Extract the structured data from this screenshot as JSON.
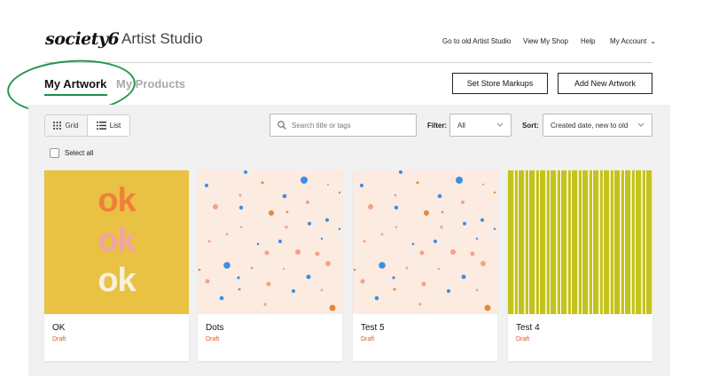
{
  "header": {
    "logo": "society6",
    "title": "Artist Studio",
    "nav": {
      "old_studio": "Go to old Artist Studio",
      "view_shop": "View My Shop",
      "help": "Help",
      "account": "My Account"
    }
  },
  "tabs": {
    "artwork": "My Artwork",
    "products": "My Products"
  },
  "actions": {
    "markups": "Set Store Markups",
    "add_artwork": "Add New Artwork"
  },
  "toolbar": {
    "grid_label": "Grid",
    "list_label": "List",
    "search_placeholder": "Search title or tags",
    "filter_label": "Filter:",
    "filter_value": "All",
    "sort_label": "Sort:",
    "sort_value": "Created date, new to old",
    "select_all": "Select all"
  },
  "artworks": [
    {
      "title": "OK",
      "status": "Draft",
      "art_text": [
        "ok",
        "ok",
        "ok"
      ]
    },
    {
      "title": "Dots",
      "status": "Draft"
    },
    {
      "title": "Test 5",
      "status": "Draft"
    },
    {
      "title": "Test 4",
      "status": "Draft"
    }
  ],
  "colors": {
    "accent_green": "#1c8d4d",
    "draft_orange": "#e0581e",
    "ok_background": "#e9c143",
    "ok_orange": "#f07f3c",
    "ok_pink": "#f2a3a8",
    "ok_cream": "#f7f1dd",
    "dots_background": "#fcebe0",
    "dot_blue": "#3a8ee6",
    "dot_pink": "#f5a08a",
    "dot_orange": "#e08a3c",
    "stripe_olive": "#c3c320"
  }
}
